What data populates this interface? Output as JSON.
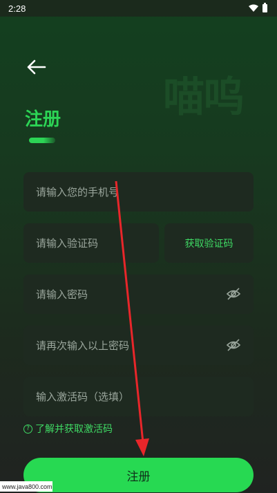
{
  "status_bar": {
    "time": "2:28"
  },
  "header": {
    "watermark": "喵呜",
    "title": "注册"
  },
  "form": {
    "phone_placeholder": "请输入您的手机号",
    "code_placeholder": "请输入验证码",
    "get_code_label": "获取验证码",
    "password_placeholder": "请输入密码",
    "confirm_password_placeholder": "请再次输入以上密码",
    "activation_placeholder": "输入激活码（选填）",
    "help_link": "了解并获取激活码",
    "submit_label": "注册"
  },
  "source_watermark": "www.java800.com",
  "colors": {
    "accent": "#2cd455",
    "field_bg": "#1e2a20",
    "annotation_arrow": "#e8262a"
  }
}
